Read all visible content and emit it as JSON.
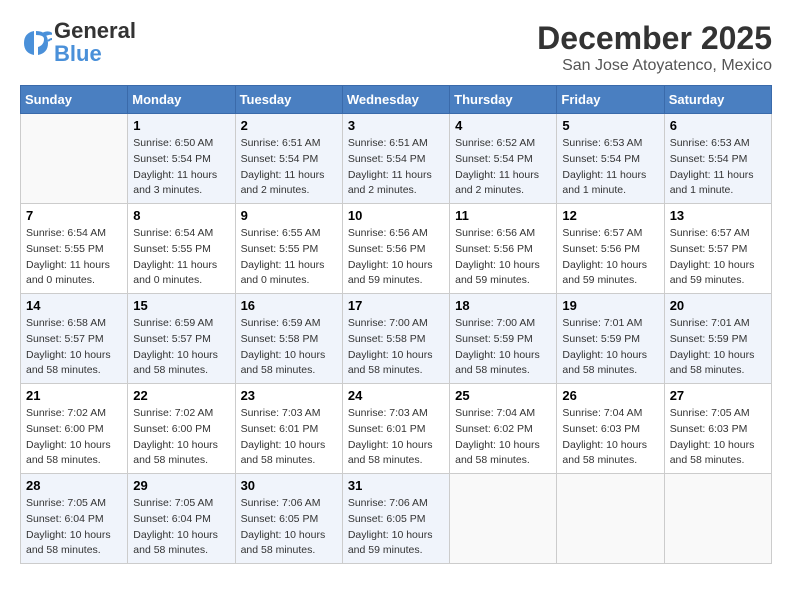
{
  "header": {
    "logo_general": "General",
    "logo_blue": "Blue",
    "month": "December 2025",
    "location": "San Jose Atoyatenco, Mexico"
  },
  "weekdays": [
    "Sunday",
    "Monday",
    "Tuesday",
    "Wednesday",
    "Thursday",
    "Friday",
    "Saturday"
  ],
  "weeks": [
    [
      {
        "day": "",
        "info": ""
      },
      {
        "day": "1",
        "info": "Sunrise: 6:50 AM\nSunset: 5:54 PM\nDaylight: 11 hours\nand 3 minutes."
      },
      {
        "day": "2",
        "info": "Sunrise: 6:51 AM\nSunset: 5:54 PM\nDaylight: 11 hours\nand 2 minutes."
      },
      {
        "day": "3",
        "info": "Sunrise: 6:51 AM\nSunset: 5:54 PM\nDaylight: 11 hours\nand 2 minutes."
      },
      {
        "day": "4",
        "info": "Sunrise: 6:52 AM\nSunset: 5:54 PM\nDaylight: 11 hours\nand 2 minutes."
      },
      {
        "day": "5",
        "info": "Sunrise: 6:53 AM\nSunset: 5:54 PM\nDaylight: 11 hours\nand 1 minute."
      },
      {
        "day": "6",
        "info": "Sunrise: 6:53 AM\nSunset: 5:54 PM\nDaylight: 11 hours\nand 1 minute."
      }
    ],
    [
      {
        "day": "7",
        "info": "Sunrise: 6:54 AM\nSunset: 5:55 PM\nDaylight: 11 hours\nand 0 minutes."
      },
      {
        "day": "8",
        "info": "Sunrise: 6:54 AM\nSunset: 5:55 PM\nDaylight: 11 hours\nand 0 minutes."
      },
      {
        "day": "9",
        "info": "Sunrise: 6:55 AM\nSunset: 5:55 PM\nDaylight: 11 hours\nand 0 minutes."
      },
      {
        "day": "10",
        "info": "Sunrise: 6:56 AM\nSunset: 5:56 PM\nDaylight: 10 hours\nand 59 minutes."
      },
      {
        "day": "11",
        "info": "Sunrise: 6:56 AM\nSunset: 5:56 PM\nDaylight: 10 hours\nand 59 minutes."
      },
      {
        "day": "12",
        "info": "Sunrise: 6:57 AM\nSunset: 5:56 PM\nDaylight: 10 hours\nand 59 minutes."
      },
      {
        "day": "13",
        "info": "Sunrise: 6:57 AM\nSunset: 5:57 PM\nDaylight: 10 hours\nand 59 minutes."
      }
    ],
    [
      {
        "day": "14",
        "info": "Sunrise: 6:58 AM\nSunset: 5:57 PM\nDaylight: 10 hours\nand 58 minutes."
      },
      {
        "day": "15",
        "info": "Sunrise: 6:59 AM\nSunset: 5:57 PM\nDaylight: 10 hours\nand 58 minutes."
      },
      {
        "day": "16",
        "info": "Sunrise: 6:59 AM\nSunset: 5:58 PM\nDaylight: 10 hours\nand 58 minutes."
      },
      {
        "day": "17",
        "info": "Sunrise: 7:00 AM\nSunset: 5:58 PM\nDaylight: 10 hours\nand 58 minutes."
      },
      {
        "day": "18",
        "info": "Sunrise: 7:00 AM\nSunset: 5:59 PM\nDaylight: 10 hours\nand 58 minutes."
      },
      {
        "day": "19",
        "info": "Sunrise: 7:01 AM\nSunset: 5:59 PM\nDaylight: 10 hours\nand 58 minutes."
      },
      {
        "day": "20",
        "info": "Sunrise: 7:01 AM\nSunset: 5:59 PM\nDaylight: 10 hours\nand 58 minutes."
      }
    ],
    [
      {
        "day": "21",
        "info": "Sunrise: 7:02 AM\nSunset: 6:00 PM\nDaylight: 10 hours\nand 58 minutes."
      },
      {
        "day": "22",
        "info": "Sunrise: 7:02 AM\nSunset: 6:00 PM\nDaylight: 10 hours\nand 58 minutes."
      },
      {
        "day": "23",
        "info": "Sunrise: 7:03 AM\nSunset: 6:01 PM\nDaylight: 10 hours\nand 58 minutes."
      },
      {
        "day": "24",
        "info": "Sunrise: 7:03 AM\nSunset: 6:01 PM\nDaylight: 10 hours\nand 58 minutes."
      },
      {
        "day": "25",
        "info": "Sunrise: 7:04 AM\nSunset: 6:02 PM\nDaylight: 10 hours\nand 58 minutes."
      },
      {
        "day": "26",
        "info": "Sunrise: 7:04 AM\nSunset: 6:03 PM\nDaylight: 10 hours\nand 58 minutes."
      },
      {
        "day": "27",
        "info": "Sunrise: 7:05 AM\nSunset: 6:03 PM\nDaylight: 10 hours\nand 58 minutes."
      }
    ],
    [
      {
        "day": "28",
        "info": "Sunrise: 7:05 AM\nSunset: 6:04 PM\nDaylight: 10 hours\nand 58 minutes."
      },
      {
        "day": "29",
        "info": "Sunrise: 7:05 AM\nSunset: 6:04 PM\nDaylight: 10 hours\nand 58 minutes."
      },
      {
        "day": "30",
        "info": "Sunrise: 7:06 AM\nSunset: 6:05 PM\nDaylight: 10 hours\nand 58 minutes."
      },
      {
        "day": "31",
        "info": "Sunrise: 7:06 AM\nSunset: 6:05 PM\nDaylight: 10 hours\nand 59 minutes."
      },
      {
        "day": "",
        "info": ""
      },
      {
        "day": "",
        "info": ""
      },
      {
        "day": "",
        "info": ""
      }
    ]
  ]
}
